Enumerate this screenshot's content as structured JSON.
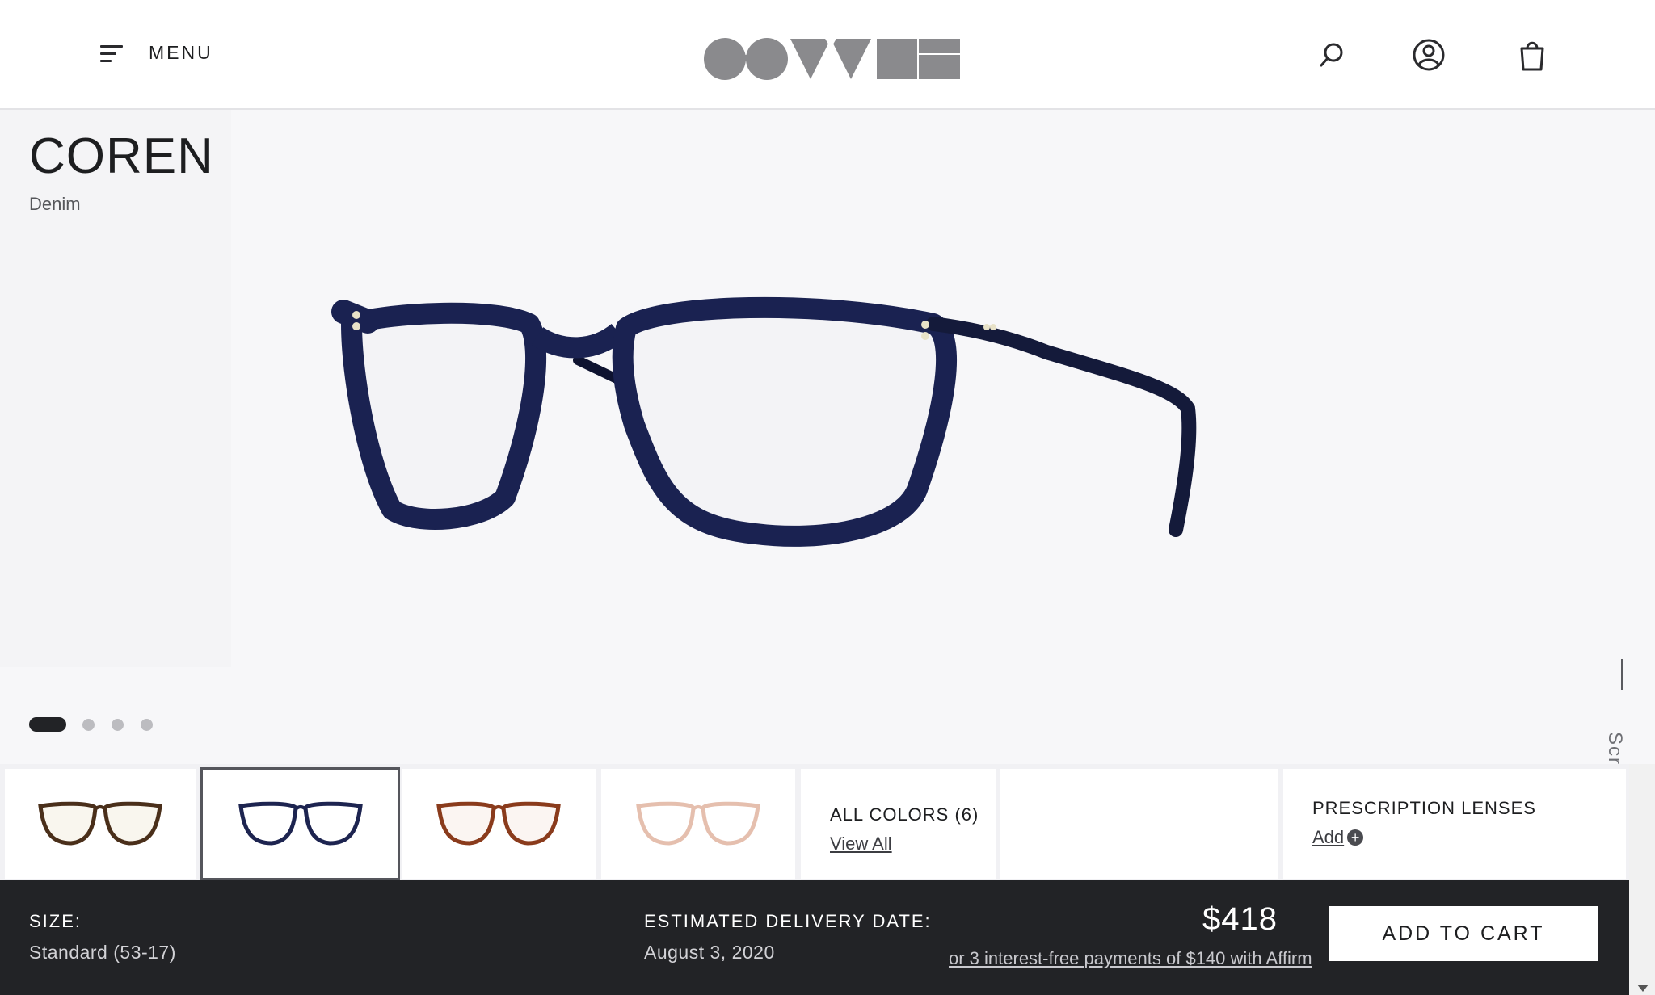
{
  "header": {
    "menu_label": "MENU",
    "logo_alt": "OLIVER PEOPLES",
    "icons": [
      "search-icon",
      "account-icon",
      "bag-icon"
    ]
  },
  "product": {
    "name": "COREN",
    "color": "Denim",
    "image_count": 4,
    "active_image": 1
  },
  "scroll_hint": "Scroll Down",
  "swatches": {
    "items": [
      {
        "name": "tortoise",
        "frame_color": "#4a2f1a",
        "accent": "#b8862c"
      },
      {
        "name": "denim",
        "frame_color": "#1d2450",
        "accent": "#1d2450",
        "selected": true
      },
      {
        "name": "amber-tortoise",
        "frame_color": "#8a3b1c",
        "accent": "#c05a2a"
      },
      {
        "name": "blush",
        "frame_color": "#e5bfae",
        "accent": "#e9cbbd"
      }
    ],
    "all_colors_label": "ALL COLORS (6)",
    "view_all_label": "View All"
  },
  "prescription": {
    "title": "PRESCRIPTION LENSES",
    "add_label": "Add "
  },
  "purchase": {
    "size_label": "SIZE:",
    "size_value": "Standard (53-17)",
    "delivery_label": "ESTIMATED DELIVERY DATE:",
    "delivery_value": "August 3, 2020",
    "price": "$418",
    "affirm_text": "or 3 interest-free payments of $140 with Affirm",
    "add_to_cart_label": "ADD TO CART"
  },
  "colors": {
    "frame_blue": "#1a2251",
    "bar_dark": "#222326",
    "hero_bg": "#f7f7f9"
  }
}
